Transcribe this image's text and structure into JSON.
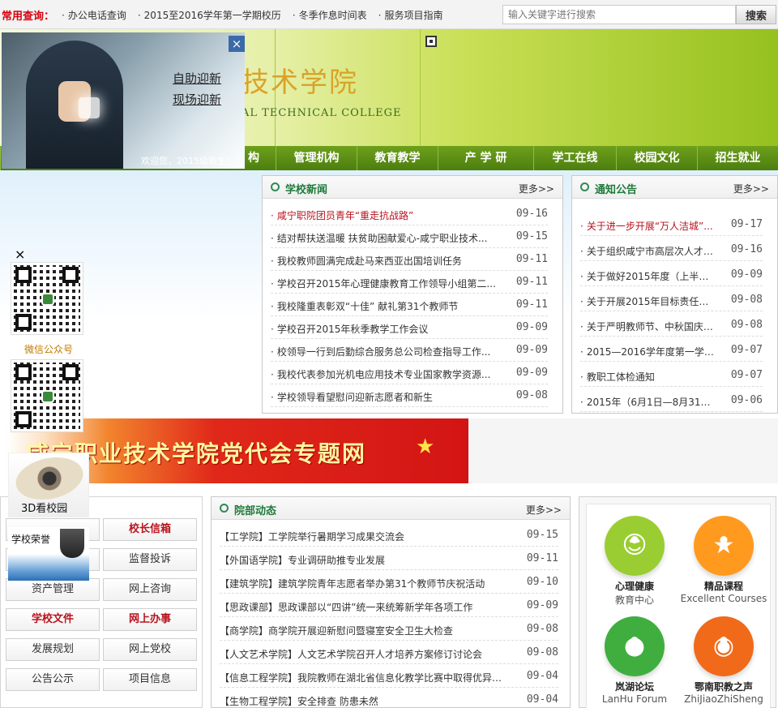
{
  "topbar": {
    "label": "常用查询：",
    "links": [
      "办公电话查询",
      "2015至2016学年第一学期校历",
      "冬季作息时间表",
      "服务项目指南"
    ],
    "search_placeholder": "输入关键字进行搜索",
    "search_button": "搜索"
  },
  "header": {
    "school_cn": "技术学院",
    "school_en": "AL TECHNICAL COLLEGE"
  },
  "nav": {
    "items": [
      "构",
      "管理机构",
      "教育教学",
      "产 学 研",
      "学工在线",
      "校园文化",
      "招生就业"
    ]
  },
  "welcome": {
    "close": "×",
    "link1": "自助迎新",
    "link2": "现场迎新",
    "caption": "欢迎您，2015级新生！"
  },
  "news": {
    "title": "学校新闻",
    "more": "更多>>",
    "items": [
      {
        "text": "咸宁职院团员青年“重走抗战路”",
        "date": "09-16"
      },
      {
        "text": "结对帮扶送温暖 扶贫助困献爱心-咸宁职业技术...",
        "date": "09-15"
      },
      {
        "text": "我校教师圆满完成赴马来西亚出国培训任务",
        "date": "09-11"
      },
      {
        "text": "学校召开2015年心理健康教育工作领导小组第二...",
        "date": "09-11"
      },
      {
        "text": "我校隆重表彰双“十佳” 献礼第31个教师节",
        "date": "09-11"
      },
      {
        "text": "学校召开2015年秋季教学工作会议",
        "date": "09-09"
      },
      {
        "text": "校领导一行到后勤综合服务总公司检查指导工作...",
        "date": "09-09"
      },
      {
        "text": "我校代表参加光机电应用技术专业国家教学资源...",
        "date": "09-09"
      },
      {
        "text": "学校领导看望慰问迎新志愿者和新生",
        "date": "09-08"
      }
    ]
  },
  "notice": {
    "title": "通知公告",
    "more": "更多>>",
    "items": [
      {
        "text": "关于进一步开展“万人洁城”...",
        "date": "09-17"
      },
      {
        "text": "关于组织咸宁市高层次人才科...",
        "date": "09-16"
      },
      {
        "text": "关于做好2015年度（上半年）...",
        "date": "09-09"
      },
      {
        "text": "关于开展2015年目标责任制管...",
        "date": "09-08"
      },
      {
        "text": "关于严明教师节、中秋国庆期...",
        "date": "09-08"
      },
      {
        "text": "2015—2016学年度第一学期第...",
        "date": "09-07"
      },
      {
        "text": "教职工体检通知",
        "date": "09-07"
      },
      {
        "text": "2015年（6月1日—8月31日）水...",
        "date": "09-06"
      }
    ]
  },
  "party_banner": "咸宁职业技术学院党代会专题网",
  "float": {
    "close": "×",
    "wechat_label": "微信公众号",
    "view3d_label": "3D看校园",
    "honor_label": "学校荣誉"
  },
  "left_grid": {
    "buttons": [
      {
        "label": "",
        "red": false
      },
      {
        "label": "校长信箱",
        "red": true
      },
      {
        "label": "",
        "red": false
      },
      {
        "label": "监督投诉",
        "red": false
      },
      {
        "label": "资产管理",
        "red": false
      },
      {
        "label": "网上咨询",
        "red": false
      },
      {
        "label": "学校文件",
        "red": true
      },
      {
        "label": "网上办事",
        "red": true
      },
      {
        "label": "发展规划",
        "red": false
      },
      {
        "label": "网上党校",
        "red": false
      },
      {
        "label": "公告公示",
        "red": false
      },
      {
        "label": "项目信息",
        "red": false
      }
    ]
  },
  "dept": {
    "title": "院部动态",
    "more": "更多>>",
    "items": [
      {
        "text": "【工学院】工学院举行暑期学习成果交流会",
        "date": "09-15"
      },
      {
        "text": "【外国语学院】专业调研助推专业发展",
        "date": "09-11"
      },
      {
        "text": "【建筑学院】建筑学院青年志愿者举办第31个教师节庆祝活动",
        "date": "09-10"
      },
      {
        "text": "【思政课部】思政课部以“四讲”统一来统筹新学年各项工作",
        "date": "09-09"
      },
      {
        "text": "【商学院】商学院开展迎新慰问暨寝室安全卫生大检查",
        "date": "09-08"
      },
      {
        "text": "【人文艺术学院】人文艺术学院召开人才培养方案修订讨论会",
        "date": "09-08"
      },
      {
        "text": "【信息工程学院】我院教师在湖北省信息化教学比赛中取得优异成...",
        "date": "09-04"
      },
      {
        "text": "【生物工程学院】安全排查 防患未然",
        "date": "09-04"
      }
    ]
  },
  "services": [
    {
      "name": "心理健康",
      "sub": "教育中心",
      "color": "#9acd32"
    },
    {
      "name": "精品课程",
      "sub": "Excellent Courses",
      "color": "#ff9a1f"
    },
    {
      "name": "岚湖论坛",
      "sub": "LanHu  Forum",
      "color": "#3fae3f"
    },
    {
      "name": "鄂南职教之声",
      "sub": "ZhiJiaoZhiSheng",
      "color": "#f06a1a"
    }
  ]
}
